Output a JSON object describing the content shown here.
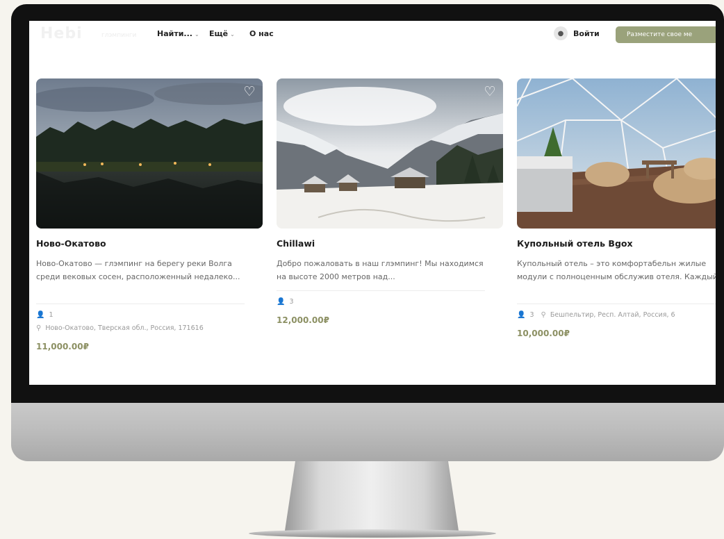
{
  "nav": {
    "logo": "Hebi",
    "logo_sub": "глэмпинги",
    "find": "Найти...",
    "more": "Ещё",
    "about": "О нас",
    "login": "Войти",
    "cta": "Разместите свое ме"
  },
  "colors": {
    "accent": "#9aa27b",
    "price": "#8c9063"
  },
  "cards": [
    {
      "title": "Ново-Окатово",
      "description": "Ново-Окатово — глэмпинг на берегу реки Волга среди вековых сосен, расположенный недалеко...",
      "guests": "1",
      "location": "Ново-Окатово, Тверская обл., Россия, 171616",
      "price": "11,000.00₽",
      "photo": "lake-at-dusk"
    },
    {
      "title": "Chillawi",
      "description": "Добро пожаловать в наш глэмпинг! Мы находимся на высоте 2000 метров над...",
      "guests": "3",
      "location": "",
      "price": "12,000.00₽",
      "photo": "snowy-mountains"
    },
    {
      "title": "Купольный отель Bgox",
      "description": "Купольный отель – это комфортабельн жилые модули с полноценным обслужив отеля. Каждый...",
      "guests": "3",
      "location": "Бешпельтир, Респ. Алтай, Россия, 6",
      "price": "10,000.00₽",
      "photo": "dome-interior"
    }
  ]
}
